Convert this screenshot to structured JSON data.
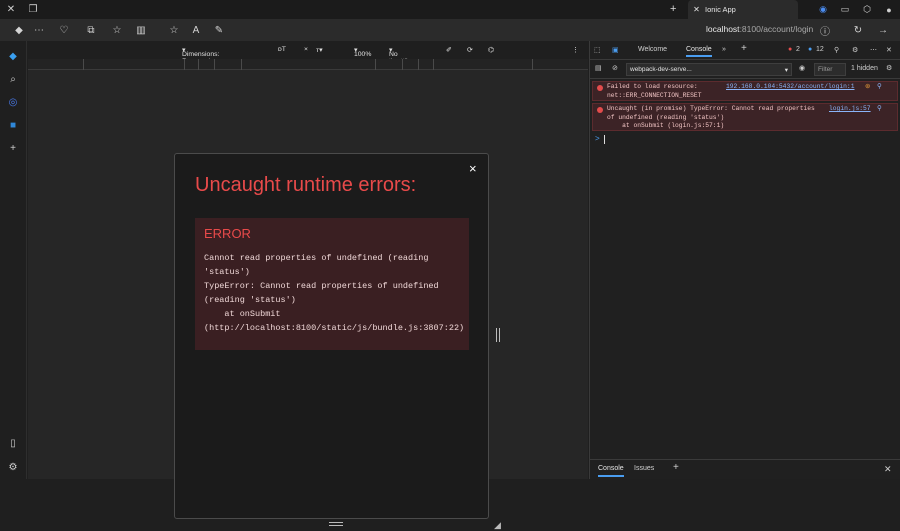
{
  "browser": {
    "tab_title": "Ionic App",
    "url_host": "localhost",
    "url_path": ":8100/account/login"
  },
  "device_toolbar": {
    "dimensions": "Dimensions: Responsive",
    "width": "ᴅΤ",
    "x": "×",
    "height": "ᴛ▾",
    "zoom": "100%",
    "throttling": "No throttling"
  },
  "overlay": {
    "title": "Uncaught runtime errors:",
    "close": "×",
    "error_label": "ERROR",
    "error_message": "Cannot read properties of undefined (reading\n'status')\nTypeError: Cannot read properties of undefined\n(reading 'status')\n    at onSubmit\n(http://localhost:8100/static/js/bundle.js:3807:22)"
  },
  "devtools": {
    "tabs": [
      "Welcome",
      "Console"
    ],
    "error_count": "2",
    "info_count": "12",
    "context": "webpack-dev-serve...",
    "filter_placeholder": "Filter",
    "hidden": "1 hidden",
    "messages": [
      {
        "text": "Failed to load resource:\nnet::ERR_CONNECTION_RESET",
        "source": "192.168.0.104:5432/account/login:1"
      },
      {
        "text": "Uncaught (in promise) TypeError: Cannot read properties\nof undefined (reading 'status')\n    at onSubmit (login.js:57:1)",
        "source": "login.js:57"
      }
    ],
    "prompt": ">",
    "drawer_tabs": [
      "Console",
      "Issues"
    ]
  },
  "colors": {
    "error_red": "#e84a4a",
    "link_blue": "#8ab4f8"
  }
}
